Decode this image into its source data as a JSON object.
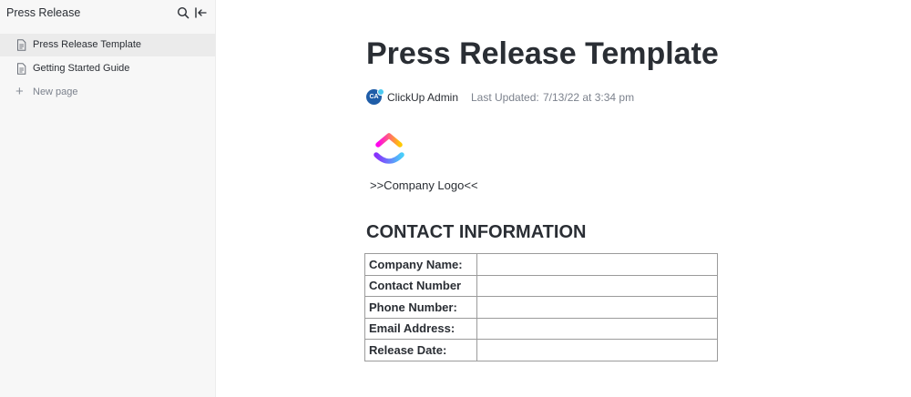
{
  "sidebar": {
    "title": "Press Release",
    "items": [
      {
        "label": "Press Release Template",
        "active": true,
        "icon": "doc-icon"
      },
      {
        "label": "Getting Started Guide",
        "active": false,
        "icon": "doc-icon"
      }
    ],
    "new_page_label": "New page"
  },
  "doc": {
    "title": "Press Release Template",
    "author": {
      "initials": "CA",
      "name": "ClickUp Admin"
    },
    "last_updated_label": "Last Updated:",
    "last_updated_value": "7/13/22 at 3:34 pm",
    "logo_caption": ">>Company Logo<<",
    "section_heading": "CONTACT INFORMATION",
    "contact_table": {
      "rows": [
        {
          "key": "Company Name:",
          "value": ""
        },
        {
          "key": "Contact Number",
          "value": ""
        },
        {
          "key": "Phone Number:",
          "value": ""
        },
        {
          "key": "Email Address:",
          "value": ""
        },
        {
          "key": "Release Date:",
          "value": ""
        }
      ]
    }
  },
  "colors": {
    "sidebar_bg": "#f7f7f7",
    "sidebar_active": "#ebebeb",
    "avatar": "#1f5da8",
    "text": "#2a2e34",
    "muted": "#7c828d"
  }
}
